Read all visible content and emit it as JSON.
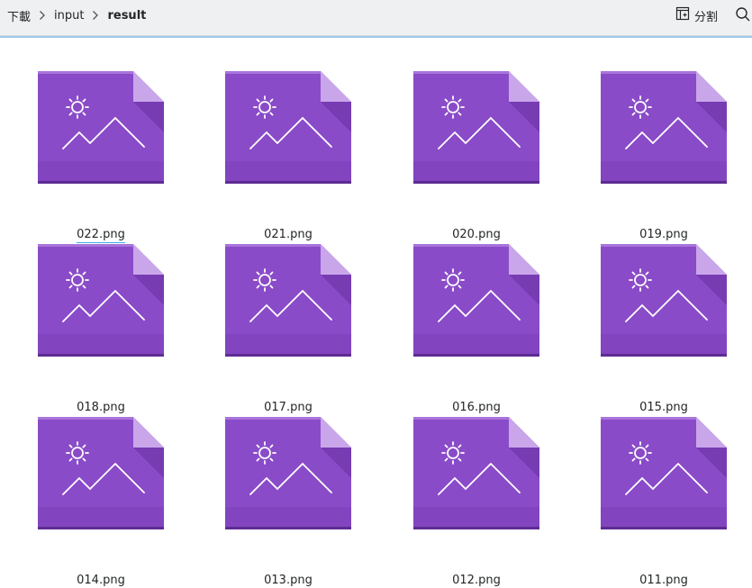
{
  "breadcrumb": {
    "items": [
      {
        "label": "下載"
      },
      {
        "label": "input"
      },
      {
        "label": "result"
      }
    ]
  },
  "toolbar": {
    "split_label": "分割",
    "split_icon": "split-view-icon",
    "search_icon": "search-icon"
  },
  "colors": {
    "icon_purple": "#8a4bc8",
    "icon_purple_dark": "#7c40b8",
    "icon_fold": "#c9a6ea",
    "accent": "#3daee9"
  },
  "files": [
    {
      "name": "022.png",
      "selected": true
    },
    {
      "name": "021.png"
    },
    {
      "name": "020.png"
    },
    {
      "name": "019.png"
    },
    {
      "name": "018.png"
    },
    {
      "name": "017.png"
    },
    {
      "name": "016.png"
    },
    {
      "name": "015.png"
    },
    {
      "name": "014.png"
    },
    {
      "name": "013.png"
    },
    {
      "name": "012.png"
    },
    {
      "name": "011.png"
    }
  ]
}
